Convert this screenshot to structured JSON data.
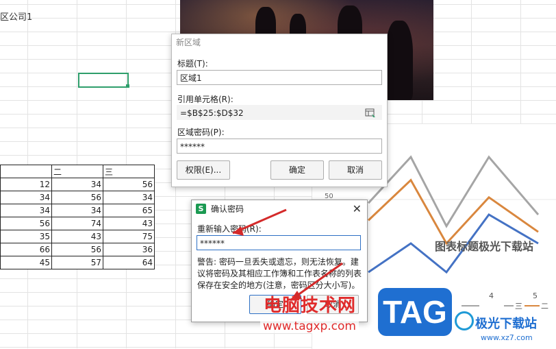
{
  "sheet": {
    "company_text": "区公司1",
    "table": {
      "header": [
        "",
        "二",
        "三"
      ],
      "rows": [
        [
          "12",
          "34",
          "56"
        ],
        [
          "34",
          "56",
          "34"
        ],
        [
          "34",
          "34",
          "65"
        ],
        [
          "56",
          "74",
          "43"
        ],
        [
          "35",
          "43",
          "75"
        ],
        [
          "66",
          "56",
          "36"
        ],
        [
          "45",
          "57",
          "64"
        ]
      ]
    }
  },
  "chart": {
    "title": "图表标题极光下载站",
    "tick_label": "50",
    "legend_numbers": [
      "4",
      "5"
    ],
    "legend_series": [
      "三",
      "二"
    ]
  },
  "chart_data": {
    "type": "line",
    "title": "图表标题极光下载站",
    "series": [
      {
        "name": "二",
        "color": "#d9873e",
        "values": [
          null,
          38,
          52,
          30,
          46,
          34
        ]
      },
      {
        "name": "三",
        "color": "#a5a5a5",
        "values": [
          null,
          44,
          60,
          36,
          60,
          40
        ]
      },
      {
        "color": "#4472c4",
        "values": [
          null,
          20,
          30,
          20,
          40,
          30
        ]
      }
    ]
  },
  "region_dialog": {
    "title": "新区域",
    "title_label": "标题(T):",
    "title_value": "区域1",
    "ref_label": "引用单元格(R):",
    "ref_value": "=$B$25:$D$32",
    "pwd_label": "区域密码(P):",
    "pwd_value": "******",
    "perm_button": "权限(E)...",
    "ok_button": "确定",
    "cancel_button": "取消"
  },
  "confirm_dialog": {
    "title": "确认密码",
    "app_badge": "S",
    "reenter_label": "重新输入密码(R):",
    "pwd_value": "******",
    "warning": "警告: 密码一旦丢失或遗忘，则无法恢复。建议将密码及其相应工作簿和工作表名称的列表保存在安全的地方(注意，密码区分大小写)。",
    "ok_button": "确定",
    "cancel_button": "取消"
  },
  "watermarks": {
    "cn": "电脑技术网",
    "url": "www.tagxp.com",
    "tag": "TAG",
    "site": "极光下载站",
    "url2": "www.xz7.com"
  },
  "colors": {
    "accent_green": "#2e9e6b",
    "focus_blue": "#2c6fc4",
    "watermark_red": "#e02b2b",
    "tag_blue": "#1f6fd1"
  }
}
